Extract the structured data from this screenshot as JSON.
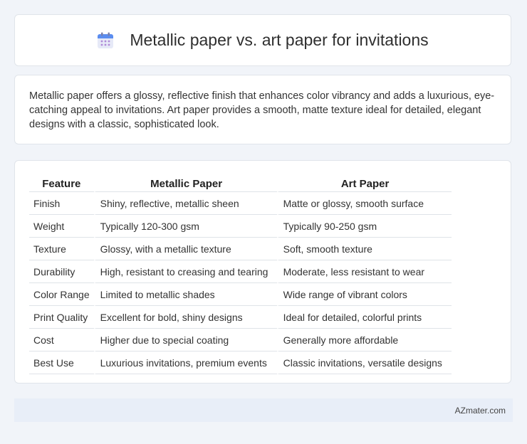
{
  "header": {
    "title": "Metallic paper vs. art paper for invitations",
    "icon": "calendar-icon"
  },
  "description": "Metallic paper offers a glossy, reflective finish that enhances color vibrancy and adds a luxurious, eye-catching appeal to invitations. Art paper provides a smooth, matte texture ideal for detailed, elegant designs with a classic, sophisticated look.",
  "table": {
    "headers": [
      "Feature",
      "Metallic Paper",
      "Art Paper"
    ],
    "rows": [
      [
        "Finish",
        "Shiny, reflective, metallic sheen",
        "Matte or glossy, smooth surface"
      ],
      [
        "Weight",
        "Typically 120-300 gsm",
        "Typically 90-250 gsm"
      ],
      [
        "Texture",
        "Glossy, with a metallic texture",
        "Soft, smooth texture"
      ],
      [
        "Durability",
        "High, resistant to creasing and tearing",
        "Moderate, less resistant to wear"
      ],
      [
        "Color Range",
        "Limited to metallic shades",
        "Wide range of vibrant colors"
      ],
      [
        "Print Quality",
        "Excellent for bold, shiny designs",
        "Ideal for detailed, colorful prints"
      ],
      [
        "Cost",
        "Higher due to special coating",
        "Generally more affordable"
      ],
      [
        "Best Use",
        "Luxurious invitations, premium events",
        "Classic invitations, versatile designs"
      ]
    ]
  },
  "footer": {
    "text": "AZmater.com"
  }
}
